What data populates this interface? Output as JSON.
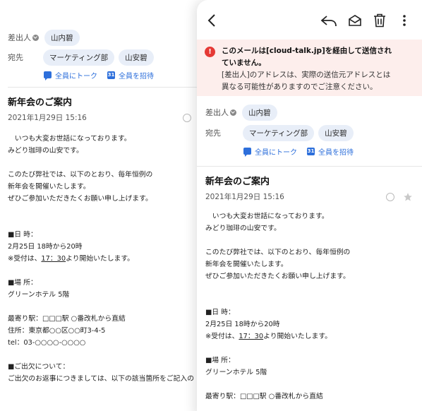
{
  "sender_label": "差出人",
  "sender_name": "山内碧",
  "to_label": "宛先",
  "recipients": [
    "マーケティング部",
    "山安碧"
  ],
  "talk_all_label": "全員にトーク",
  "invite_all_label": "全員を招待",
  "calendar_icon_text": "31",
  "subject": "新年会のご案内",
  "date": "2021年1月29日 15:16",
  "body": {
    "line1": "　いつも大変お世話になっております。",
    "line2": "みどり珈琲の山安です。",
    "line3": "このたび弊社では、以下のとおり、毎年恒例の",
    "line4": "新年会を開催いたします。",
    "line5": "ぜひご参加いただきたくお願い申し上げます。",
    "date_heading": "■日 時：",
    "date_value": "2月25日 18時から20時",
    "reception_prefix": "※受付は、",
    "reception_time": "17：30",
    "reception_suffix": "より開始いたします。",
    "place_heading": "■場 所：",
    "place_value": "グリーンホテル 5階",
    "station": "最寄り駅：□□□駅 ○番改札から直結",
    "address": "住所：東京都○○区○○町3-4-5",
    "tel": "tel：03-○○○○-○○○○",
    "attendance_heading": "■ご出欠について：",
    "attendance_text": "ご出欠のお返事につきましては、以下の該当箇所をご記入の"
  },
  "alert": {
    "title_line1": "このメールは[cloud-talk.jp]を経由して送信され",
    "title_line2": "ていません。",
    "body_line1": "[差出人]のアドレスは、実際の送信元アドレスとは",
    "body_line2": "異なる可能性がありますのでご注意ください。"
  },
  "toolbar_icons": [
    "back-icon",
    "reply-icon",
    "mark-unread-icon",
    "trash-icon",
    "more-icon"
  ],
  "colors": {
    "accent": "#2d6fdb",
    "alert_bg": "#fdeeec",
    "alert_icon": "#e53935",
    "chip_bg": "#e8eef8"
  }
}
